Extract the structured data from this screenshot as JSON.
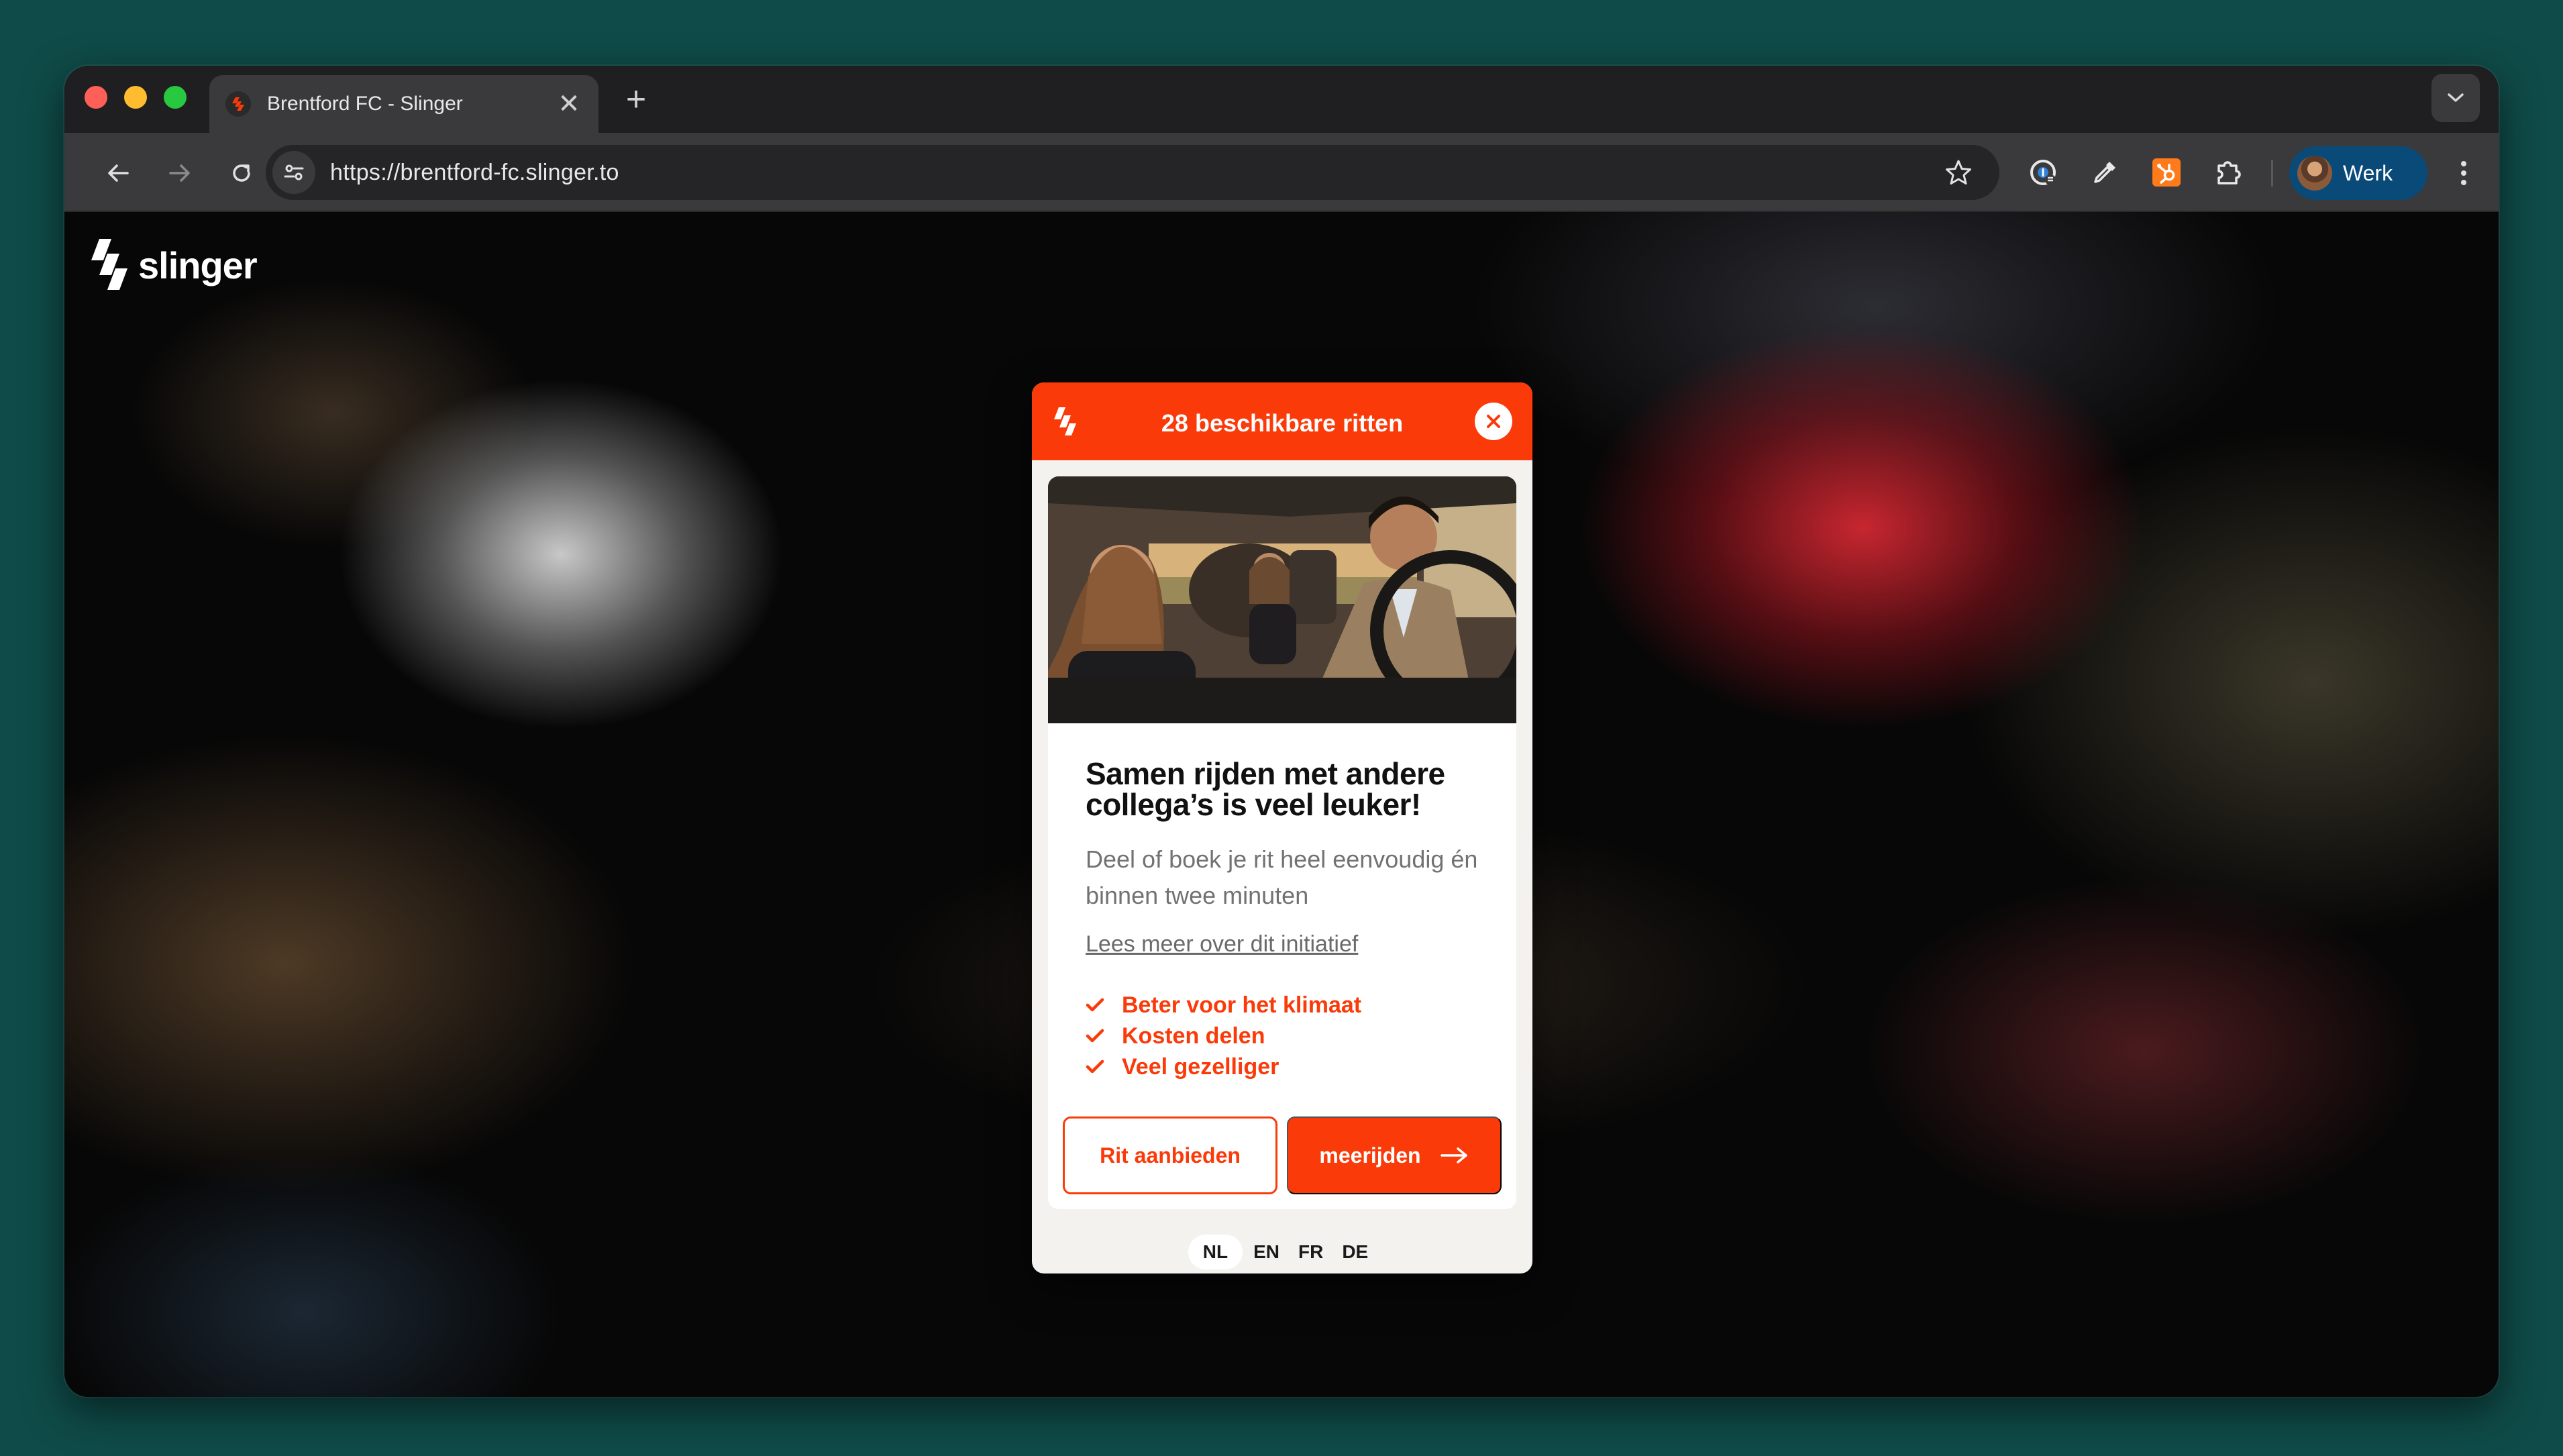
{
  "browser": {
    "tab": {
      "title": "Brentford FC - Slinger",
      "close": "✕"
    },
    "new_tab": "+",
    "url": "https://brentford-fc.slinger.to",
    "profile": {
      "label": "Werk"
    }
  },
  "page": {
    "brand": "slinger",
    "modal": {
      "count": "28 beschikbare ritten",
      "headline": "Samen rijden met andere collega’s is veel leuker!",
      "subtext": "Deel of boek je rit heel eenvoudig én binnen twee minuten",
      "learn_more": "Lees meer over dit initiatief",
      "benefits": [
        "Beter voor het klimaat",
        "Kosten delen",
        "Veel gezelliger"
      ],
      "offer_ride": "Rit aanbieden",
      "join_ride": "meerijden",
      "languages": [
        "NL",
        "EN",
        "FR",
        "DE"
      ],
      "active_language": "NL"
    }
  },
  "colors": {
    "accent": "#fb3a09",
    "desktop": "#0f4b48",
    "profile_chip": "#0a4a78"
  }
}
